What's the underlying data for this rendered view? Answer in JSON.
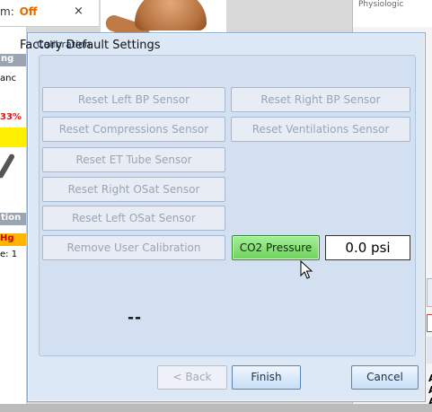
{
  "background": {
    "tab_field_label": "m:",
    "tab_field_value": "Off",
    "tab_close": "×",
    "right_top_text": "Physiologic",
    "left_strip": [
      "ng",
      "anc",
      "33%",
      "tion",
      "Hg",
      "e: 1"
    ],
    "right_letters": [
      "A",
      "A",
      "A"
    ]
  },
  "dialog": {
    "title": "Calibration",
    "group_title": "Factory Default Settings",
    "buttons": {
      "reset_left_bp": "Reset Left BP Sensor",
      "reset_right_bp": "Reset Right BP Sensor",
      "reset_compressions": "Reset Compressions Sensor",
      "reset_ventilations": "Reset Ventilations Sensor",
      "reset_et_tube": "Reset ET Tube Sensor",
      "reset_right_osat": "Reset Right OSat Sensor",
      "reset_left_osat": "Reset Left OSat Sensor",
      "remove_user_calibration": "Remove User Calibration",
      "co2_pressure": "CO2 Pressure"
    },
    "co2_readout": "0.0 psi",
    "status_text": "--",
    "footer": {
      "back": "< Back",
      "finish": "Finish",
      "cancel": "Cancel"
    }
  },
  "colors": {
    "co2_button": "#7bdc67",
    "dialog_bg": "#dde8f6",
    "accent_orange": "#e06b00"
  }
}
